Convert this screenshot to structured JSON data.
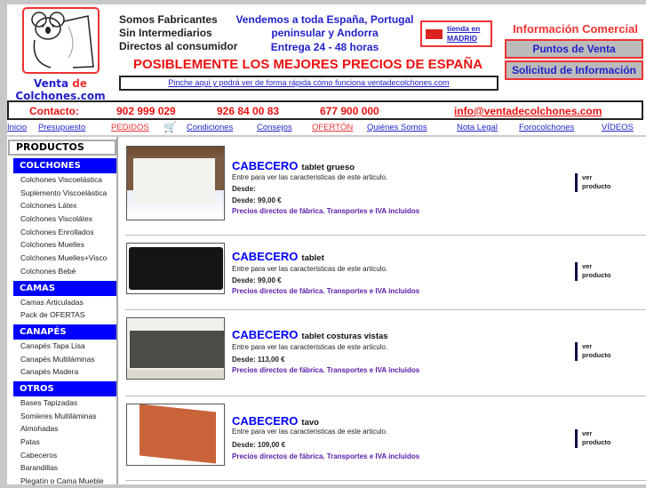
{
  "logo": {
    "line1a": "Venta",
    "line1b": "de",
    "line2": "Colchones.com"
  },
  "slogans": [
    "Somos Fabricantes",
    "Sin Intermediarios",
    "Directos al consumidor"
  ],
  "shipping": [
    "Vendemos a toda España, Portugal",
    "peninsular y Andorra",
    "Entrega 24 - 48 horas"
  ],
  "madrid": {
    "line1": "tienda en",
    "line2": "MADRID"
  },
  "info": {
    "title": "Información Comercial",
    "buttons": [
      "Puntos de Venta",
      "Solicitud de Información"
    ]
  },
  "headline": "POSIBLEMENTE LOS MEJORES PRECIOS DE ESPAÑA",
  "how_link": "Pinche aquí y podrá ver de forma rápida cómo funciona ventadecolchones.com",
  "contact": {
    "label": "Contacto:",
    "phones": [
      "902 999 029",
      "926 84 00 83",
      "677 900 000"
    ],
    "email": "info@ventadecolchones.com"
  },
  "nav": [
    "Inicio",
    "Presupuesto",
    "PEDIDOS",
    "Condiciones",
    "Consejos",
    "OFERTÓN",
    "Quiénes Somos",
    "Nota Legal",
    "Forocolchones",
    "VÍDEOS"
  ],
  "sidebar": {
    "title": "PRODUCTOS",
    "categories": [
      {
        "name": "COLCHONES",
        "items": [
          "Colchones Viscoelástica",
          "Suplemento Viscoelástica",
          "Colchones Látex",
          "Colchones Viscolátex",
          "Colchones Enrollados",
          "Colchones Muelles",
          "Colchones Muelles+Visco",
          "Colchones Bebé"
        ]
      },
      {
        "name": "CAMAS",
        "items": [
          "Camas Articuladas",
          "Pack de OFERTAS"
        ]
      },
      {
        "name": "CANAPÉS",
        "items": [
          "Canapés Tapa Lisa",
          "Canapés Multiláminas",
          "Canapés Madera"
        ]
      },
      {
        "name": "OTROS",
        "items": [
          "Bases Tapizadas",
          "Somieres Multiláminas",
          "Almohadas",
          "Patas",
          "Cabeceros",
          "Barandillas",
          "Plegatín o Cama Mueble"
        ]
      }
    ]
  },
  "products": [
    {
      "name": "CABECERO",
      "sub": "tablet grueso",
      "desc": "Entre para ver las caracteristicas de este articulo.",
      "desde_blank": "Desde:",
      "price": "Desde: 99,00 €",
      "note": "Precios directos de fábrica. Transportes e IVA incluidos",
      "link": "ver producto"
    },
    {
      "name": "CABECERO",
      "sub": "tablet",
      "desc": "Entre para ver las caracteristicas de este articulo.",
      "price": "Desde: 99,00 €",
      "note": "Precios directos de fábrica. Transportes e IVA incluidos",
      "link": "ver producto"
    },
    {
      "name": "CABECERO",
      "sub": "tablet costuras vistas",
      "desc": "Entre para ver las caracteristicas de este articulo.",
      "price": "Desde: 113,00 €",
      "note": "Precios directos de fábrica. Transportes e IVA incluidos",
      "link": "ver producto"
    },
    {
      "name": "CABECERO",
      "sub": "tavo",
      "desc": "Entre para ver las caracteristicas de este articulo.",
      "price": "Desde: 109,00 €",
      "note": "Precios directos de fábrica. Transportes e IVA incluidos",
      "link": "ver producto"
    }
  ]
}
